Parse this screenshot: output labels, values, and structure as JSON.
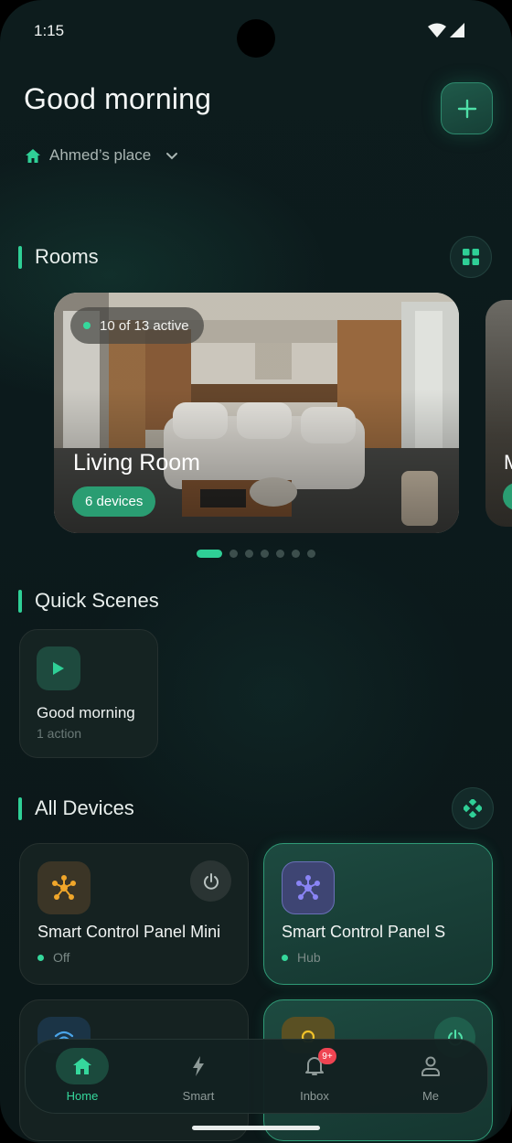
{
  "status_bar": {
    "time": "1:15"
  },
  "header": {
    "greeting": "Good morning",
    "home_name": "Ahmed’s place"
  },
  "rooms": {
    "title": "Rooms",
    "cards": [
      {
        "active_text": "10 of 13 active",
        "name": "Living Room",
        "devices": "6 devices"
      },
      {
        "name": "M"
      }
    ],
    "page_count": 7,
    "current_page": 1
  },
  "quick_scenes": {
    "title": "Quick Scenes",
    "items": [
      {
        "name": "Good morning",
        "sub": "1 action"
      }
    ]
  },
  "all_devices": {
    "title": "All Devices",
    "items": [
      {
        "name": "Smart Control Panel Mini",
        "status": "Off",
        "icon": "hub-icon",
        "icon_color": "#f0a62a",
        "on": false
      },
      {
        "name": "Smart Control Panel S",
        "status": "Hub",
        "icon": "hub-icon",
        "icon_color": "#8a84f5",
        "on": true
      }
    ]
  },
  "nav": {
    "items": [
      {
        "label": "Home",
        "icon": "home-icon",
        "active": true
      },
      {
        "label": "Smart",
        "icon": "bolt-icon",
        "active": false
      },
      {
        "label": "Inbox",
        "icon": "bell-icon",
        "active": false,
        "badge": "9+"
      },
      {
        "label": "Me",
        "icon": "person-icon",
        "active": false
      }
    ]
  },
  "colors": {
    "accent": "#2fcf96",
    "badge": "#ef4452"
  }
}
